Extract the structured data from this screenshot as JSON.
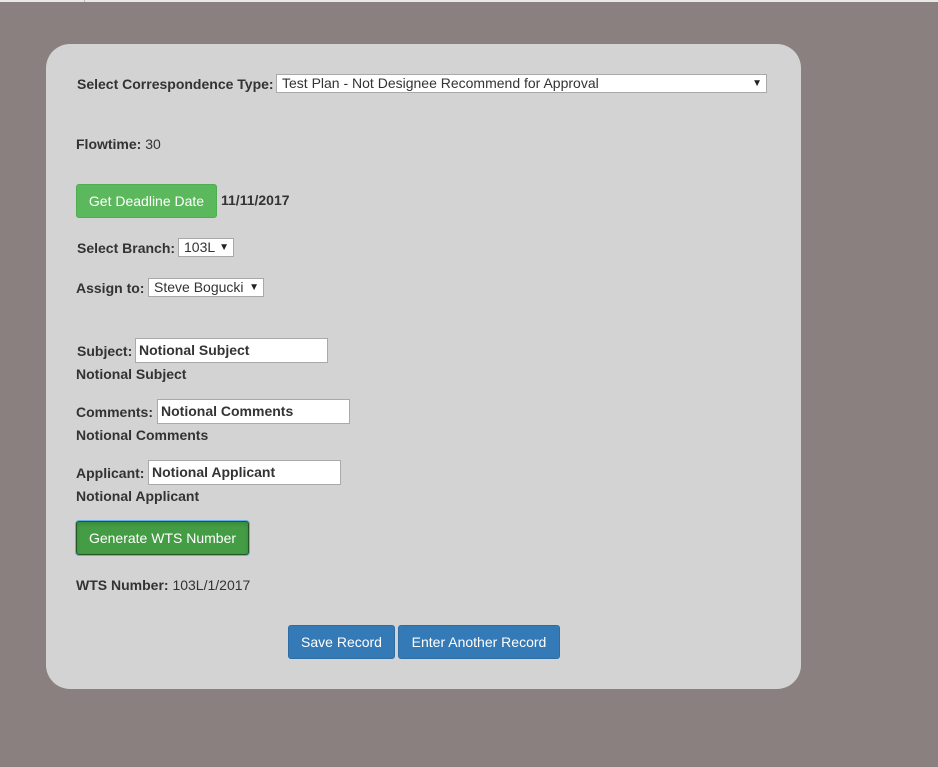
{
  "form": {
    "correspondence_type": {
      "label": "Select Correspondence Type:",
      "selected": "Test Plan - Not Designee Recommend for Approval"
    },
    "flowtime": {
      "label": "Flowtime:",
      "value": "30"
    },
    "deadline": {
      "button_label": "Get Deadline Date",
      "date": "11/11/2017"
    },
    "branch": {
      "label": "Select Branch:",
      "selected": "103L"
    },
    "assign_to": {
      "label": "Assign to:",
      "selected": "Steve Bogucki"
    },
    "subject": {
      "label": "Subject:",
      "value": "Notional Subject",
      "echo": "Notional Subject"
    },
    "comments": {
      "label": "Comments:",
      "value": "Notional Comments",
      "echo": "Notional Comments"
    },
    "applicant": {
      "label": "Applicant:",
      "value": "Notional Applicant",
      "echo": "Notional Applicant"
    },
    "generate_button_label": "Generate WTS Number",
    "wts_number": {
      "label": "WTS Number:",
      "value": "103L/1/2017"
    }
  },
  "actions": {
    "save_label": "Save Record",
    "another_label": "Enter Another Record"
  },
  "icons": {
    "dropdown": "caret-down-icon"
  },
  "colors": {
    "background": "#8a8080",
    "panel": "#d3d3d3",
    "success": "#5cb85c",
    "primary": "#337ab7"
  }
}
